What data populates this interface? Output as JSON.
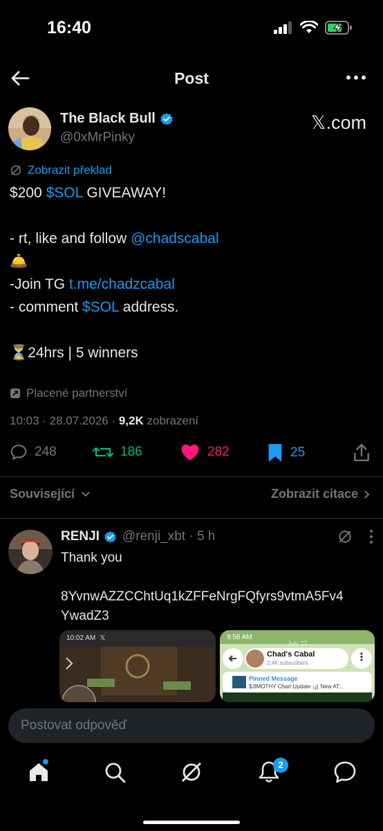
{
  "status_bar": {
    "time": "16:40"
  },
  "header": {
    "title": "Post"
  },
  "author": {
    "name": "The Black Bull",
    "handle": "@0xMrPinky",
    "watermark": "𝕏.com"
  },
  "translate_label": "Zobrazit překlad",
  "post": {
    "line1_a": "$200 ",
    "line1_link": "$SOL",
    "line1_b": " GIVEAWAY!",
    "line2_a": "- rt, like and follow ",
    "line2_link": "@chadscabal",
    "line3_emoji": "🛎️",
    "line4_a": "-Join  TG ",
    "line4_link": "t.me/chadzcabal",
    "line5_a": "- comment ",
    "line5_link": "$SOL",
    "line5_b": " address.",
    "line6": "⏳24hrs | 5 winners"
  },
  "paid_label": "Placené partnerství",
  "meta": {
    "time_date": "10:03 · 28.07.2026 · ",
    "views": "9,2K",
    "views_label": " zobrazení"
  },
  "actions": {
    "replies": "248",
    "reposts": "186",
    "likes": "282",
    "bookmarks": "25"
  },
  "related_label": "Související",
  "quotes_label": "Zobrazit citace",
  "reply": {
    "name": "RENJI",
    "handle": "@renji_xbt · 5 h",
    "text1": "Thank you",
    "text2": "8YvnwAZZCChtUq1kZFFeNrgFQfyrs9vtmA5Fv4",
    "text3": "YwadZ3"
  },
  "media_left": {
    "time": "10:02 AM",
    "logo": "𝕏"
  },
  "media_right": {
    "time": "9:58 AM",
    "date": "July 27",
    "channel": "Chad's Cabal",
    "subscribers": "2.4K subscribers",
    "pinned_label": "Pinned Message",
    "pinned_text": "$JIMOTHY Chart Update 📊 New AT..."
  },
  "composer": {
    "placeholder": "Postovat odpověď"
  },
  "nav": {
    "notifications_badge": "2"
  },
  "colors": {
    "accent": "#1d9bf0",
    "repost": "#00ba7c",
    "like": "#f91880",
    "background": "#000000"
  }
}
